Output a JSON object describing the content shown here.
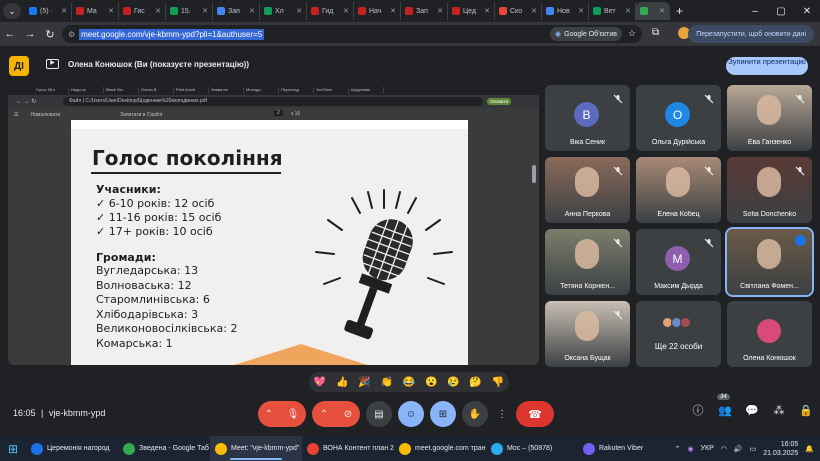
{
  "browser": {
    "tabs": [
      {
        "label": "(5) ·",
        "color": "#1877f2"
      },
      {
        "label": "Ma",
        "color": "#c5221f"
      },
      {
        "label": "Гис",
        "color": "#c5221f"
      },
      {
        "label": "15.",
        "color": "#0f9d58"
      },
      {
        "label": "Зап",
        "color": "#4285f4"
      },
      {
        "label": "Хл",
        "color": "#0f9d58"
      },
      {
        "label": "Гид",
        "color": "#c5221f"
      },
      {
        "label": "Нач",
        "color": "#c5221f"
      },
      {
        "label": "Зап",
        "color": "#c5221f"
      },
      {
        "label": "Цед",
        "color": "#c5221f"
      },
      {
        "label": "Ско",
        "color": "#e8453c"
      },
      {
        "label": "Нов",
        "color": "#4285f4"
      },
      {
        "label": "Вет",
        "color": "#0f9d58"
      },
      {
        "label": "",
        "color": "#34a853"
      }
    ],
    "url": "meet.google.com/vje-kbmm-ypd?pli=1&authuser=5",
    "lens_label": "Google Об'єктив",
    "restart_label": "Перезапустити, щоб оновити дані"
  },
  "meet": {
    "presenter_text": "Олена Конюшок (Ви (показуєте презентацію))",
    "stop_label": "Зупинити презентацію",
    "logo": "ДІ",
    "meeting_code": "vje-kbmm-ypd",
    "time": "16:05",
    "participant_count": "34"
  },
  "shared": {
    "tabs": [
      "Голос 08 к",
      "Нади зо",
      "Black Stu",
      "Ocean B",
      "Print Avoid",
      "Заява на",
      "Молоди",
      "Переглад",
      "YouTube",
      "Щоденник"
    ],
    "path": "Файл | C:/Users/User/Desktop/Щоденник%20молодіжних.pdf",
    "zoom_btn": "Оновити",
    "toolbar": {
      "draw": "Намалювати",
      "copilot": "Запитати в Copilot",
      "page": "2",
      "of": "з 16"
    }
  },
  "slide": {
    "title": "Голос покоління",
    "participants_heading": "Учасники:",
    "participants": [
      "6-10 років: 12 осіб",
      "11-16 років: 15 осіб",
      "17+ років: 10 осіб"
    ],
    "communities_heading": "Громади:",
    "communities": [
      "Вугледарська: 13",
      "Волноваська: 12",
      "Старомлинівська: 6",
      "Хлібодарівська: 3",
      "Великоновосілківська: 2",
      "Комарська: 1"
    ]
  },
  "participants": [
    {
      "name": "Віка Сеник",
      "initial": "В",
      "color": "#5c6bc0",
      "kind": "avatar"
    },
    {
      "name": "Ольга Дурійська",
      "initial": "О",
      "color": "#1e88e5",
      "kind": "avatar"
    },
    {
      "name": "Ева Ганзенко",
      "kind": "photo",
      "color": "#b9a898"
    },
    {
      "name": "Анна Перкова",
      "kind": "photo",
      "color": "#8a6a5a"
    },
    {
      "name": "Елена Кобец",
      "kind": "photo",
      "color": "#a88a76"
    },
    {
      "name": "Sofia Donchenko",
      "kind": "photo",
      "color": "#5a3a36"
    },
    {
      "name": "Тетяна Корнієн...",
      "kind": "photo",
      "color": "#7b7e6a"
    },
    {
      "name": "Максим Дырда",
      "initial": "М",
      "color": "#8e5eb0",
      "kind": "avatar"
    },
    {
      "name": "Світлана Фомен...",
      "kind": "photo",
      "color": "#6a5a48"
    },
    {
      "name": "Оксана Бущак",
      "kind": "photo",
      "color": "#c9bfb4"
    },
    {
      "name": "Ще 22 особи",
      "kind": "more",
      "color": "#3c4043"
    },
    {
      "name": "Олена Конюшок",
      "kind": "self",
      "color": "#d84a7a"
    }
  ],
  "reactions": [
    "💖",
    "👍",
    "🎉",
    "👏",
    "😂",
    "😮",
    "😢",
    "🤔",
    "👎"
  ],
  "taskbar": [
    {
      "label": "Церемонія нагород",
      "color": "#1a73e8"
    },
    {
      "label": "Зведена - Google Таб",
      "color": "#34a853"
    },
    {
      "label": "Meet: \"vje-kbmm-ypd\"",
      "color": "#fbbc05"
    },
    {
      "label": "ВОНА Контент план 2",
      "color": "#ea4335"
    },
    {
      "label": "meet.google.com тран",
      "color": "#fbbc05"
    },
    {
      "label": "Мос – (50878)",
      "color": "#2aabee"
    },
    {
      "label": "Rakuten Viber",
      "color": "#7360f2"
    }
  ],
  "tray": {
    "lang": "УКР",
    "time": "16:05",
    "date": "21.03.2025"
  }
}
